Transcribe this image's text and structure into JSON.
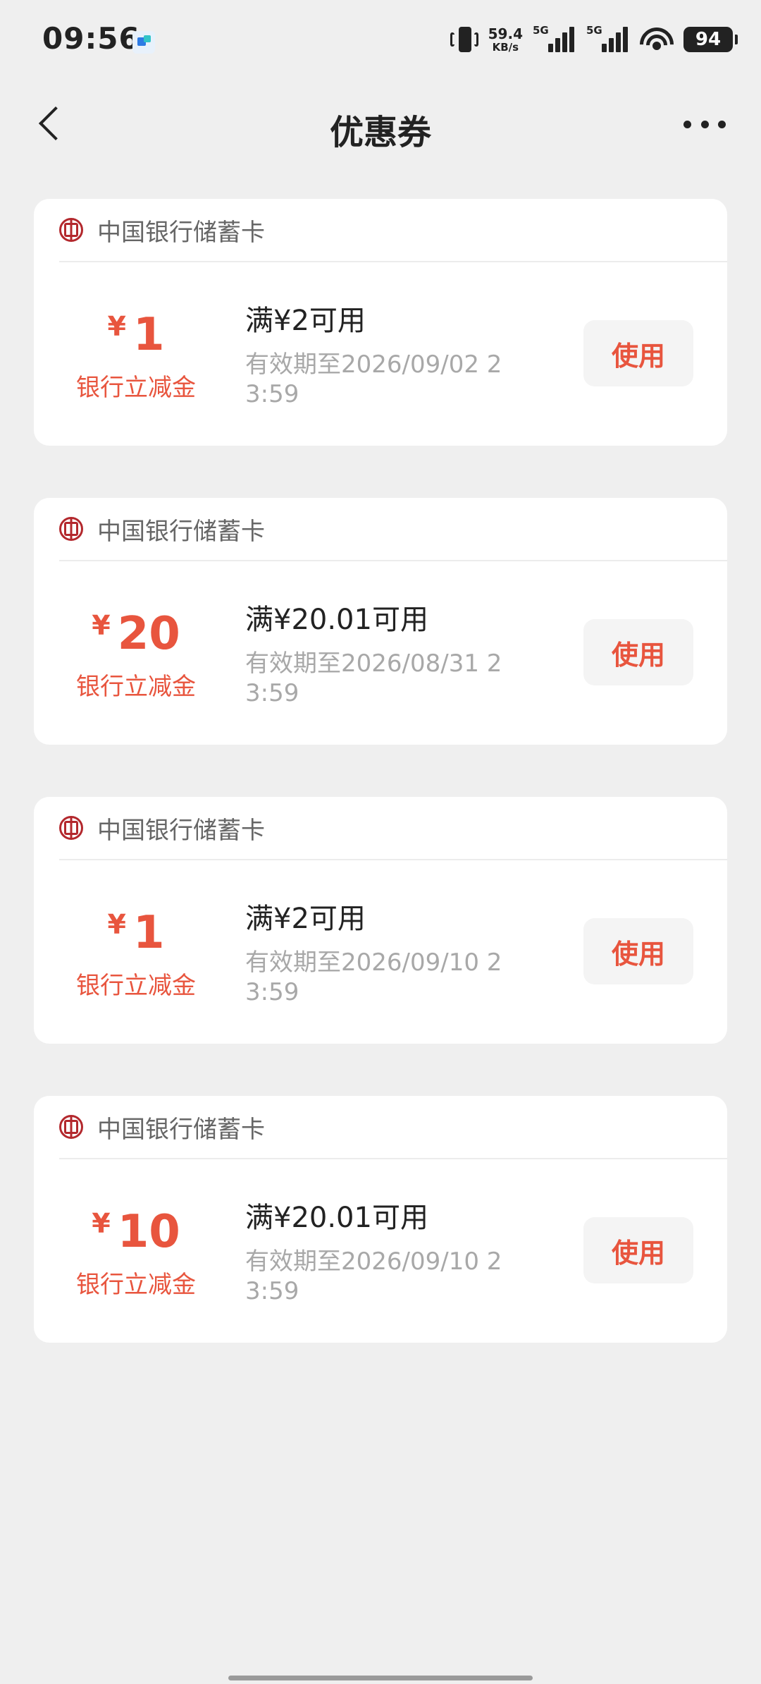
{
  "status": {
    "time": "09:56",
    "net_speed_value": "59.4",
    "net_speed_unit": "KB/s",
    "signal1_label": "5G",
    "signal2_label": "5G",
    "battery": "94"
  },
  "header": {
    "title": "优惠券"
  },
  "coupons": [
    {
      "bank": "中国银行储蓄卡",
      "currency": "¥",
      "amount": "1",
      "amount_label": "银行立减金",
      "condition": "满¥2可用",
      "validity": "有效期至2026/09/02 23:59",
      "button": "使用"
    },
    {
      "bank": "中国银行储蓄卡",
      "currency": "¥",
      "amount": "20",
      "amount_label": "银行立减金",
      "condition": "满¥20.01可用",
      "validity": "有效期至2026/08/31 23:59",
      "button": "使用"
    },
    {
      "bank": "中国银行储蓄卡",
      "currency": "¥",
      "amount": "1",
      "amount_label": "银行立减金",
      "condition": "满¥2可用",
      "validity": "有效期至2026/09/10 23:59",
      "button": "使用"
    },
    {
      "bank": "中国银行储蓄卡",
      "currency": "¥",
      "amount": "10",
      "amount_label": "银行立减金",
      "condition": "满¥20.01可用",
      "validity": "有效期至2026/09/10 23:59",
      "button": "使用"
    }
  ],
  "colors": {
    "accent": "#e8553e",
    "bank_red": "#b3282d",
    "background": "#efefef"
  },
  "icons": {
    "back": "chevron-left-icon",
    "more": "more-dots-icon",
    "bank": "boc-logo-icon"
  }
}
